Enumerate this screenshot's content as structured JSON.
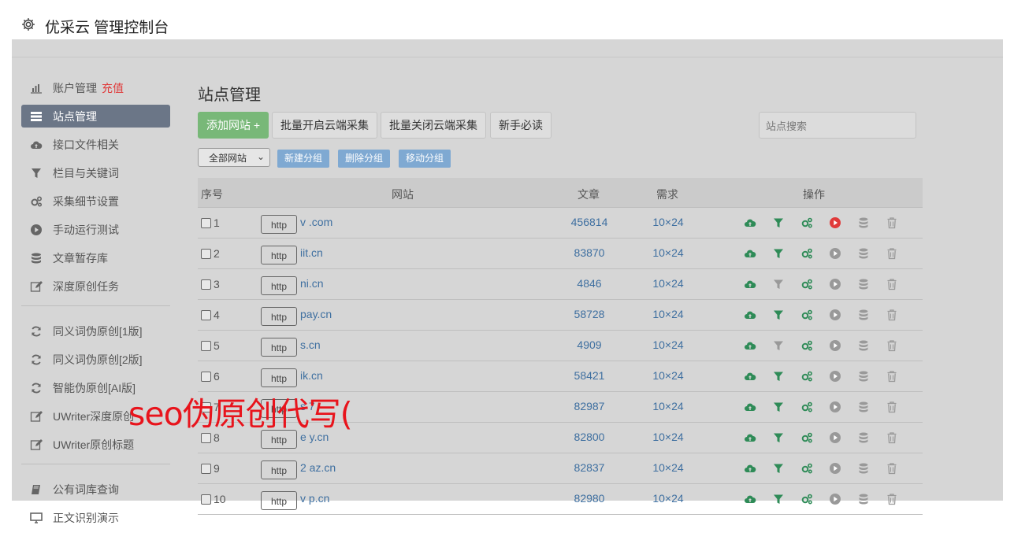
{
  "app": {
    "title": "优采云 管理控制台"
  },
  "sidebar": {
    "groups": [
      [
        {
          "label": "账户管理",
          "badge": "充值",
          "icon": "bar-chart-icon",
          "active": false
        },
        {
          "label": "站点管理",
          "badge": "",
          "icon": "server-list-icon",
          "active": true
        },
        {
          "label": "接口文件相关",
          "badge": "",
          "icon": "cloud-upload-icon",
          "active": false
        },
        {
          "label": "栏目与关键词",
          "badge": "",
          "icon": "filter-icon",
          "active": false
        },
        {
          "label": "采集细节设置",
          "badge": "",
          "icon": "gears-icon",
          "active": false
        },
        {
          "label": "手动运行测试",
          "badge": "",
          "icon": "play-circle-icon",
          "active": false
        },
        {
          "label": "文章暂存库",
          "badge": "",
          "icon": "database-icon",
          "active": false
        },
        {
          "label": "深度原创任务",
          "badge": "",
          "icon": "edit-icon",
          "active": false
        }
      ],
      [
        {
          "label": "同义词伪原创[1版]",
          "badge": "",
          "icon": "refresh-icon",
          "active": false
        },
        {
          "label": "同义词伪原创[2版]",
          "badge": "",
          "icon": "refresh-icon",
          "active": false
        },
        {
          "label": "智能伪原创[AI版]",
          "badge": "",
          "icon": "refresh-icon",
          "active": false
        },
        {
          "label": "UWriter深度原创",
          "badge": "",
          "icon": "edit-icon",
          "active": false
        },
        {
          "label": "UWriter原创标题",
          "badge": "",
          "icon": "edit-icon",
          "active": false
        }
      ],
      [
        {
          "label": "公有词库查询",
          "badge": "",
          "icon": "book-icon",
          "active": false
        },
        {
          "label": "正文识别演示",
          "badge": "",
          "icon": "monitor-icon",
          "active": false
        }
      ]
    ]
  },
  "main": {
    "title": "站点管理",
    "toolbar": {
      "add_site": "添加网站 +",
      "enable_cloud": "批量开启云端采集",
      "disable_cloud": "批量关闭云端采集",
      "guide": "新手必读",
      "search_placeholder": "站点搜索"
    },
    "groupbar": {
      "select_value": "全部网站",
      "new_group": "新建分组",
      "delete_group": "删除分组",
      "move_group": "移动分组"
    },
    "table": {
      "headers": {
        "index": "序号",
        "site": "网站",
        "articles": "文章",
        "demand": "需求",
        "ops": "操作"
      },
      "http_label": "http",
      "rows": [
        {
          "index": "1",
          "site": "v           .com",
          "articles": "456814",
          "demand": "10×24",
          "running": true,
          "filter_active": true
        },
        {
          "index": "2",
          "site": "      iit.cn",
          "articles": "83870",
          "demand": "10×24",
          "running": false,
          "filter_active": true
        },
        {
          "index": "3",
          "site": "      ni.cn",
          "articles": "4846",
          "demand": "10×24",
          "running": false,
          "filter_active": false
        },
        {
          "index": "4",
          "site": "        pay.cn",
          "articles": "58728",
          "demand": "10×24",
          "running": false,
          "filter_active": true
        },
        {
          "index": "5",
          "site": "        s.cn",
          "articles": "4909",
          "demand": "10×24",
          "running": false,
          "filter_active": false
        },
        {
          "index": "6",
          "site": "      ik.cn",
          "articles": "58421",
          "demand": "10×24",
          "running": false,
          "filter_active": true
        },
        {
          "index": "7",
          "site": "s      7",
          "articles": "82987",
          "demand": "10×24",
          "running": false,
          "filter_active": true
        },
        {
          "index": "8",
          "site": "e      y.cn",
          "articles": "82800",
          "demand": "10×24",
          "running": false,
          "filter_active": true
        },
        {
          "index": "9",
          "site": "2      az.cn",
          "articles": "82837",
          "demand": "10×24",
          "running": false,
          "filter_active": true
        },
        {
          "index": "10",
          "site": "v      p.cn",
          "articles": "82980",
          "demand": "10×24",
          "running": false,
          "filter_active": true
        }
      ]
    }
  },
  "overlay": {
    "text": "seo伪原创代写("
  },
  "colors": {
    "accent_green": "#2e8b57",
    "link_blue": "#3e6fa0",
    "danger_red": "#e03a3a",
    "muted_gray": "#999999",
    "overlay_red": "#e8141c"
  }
}
